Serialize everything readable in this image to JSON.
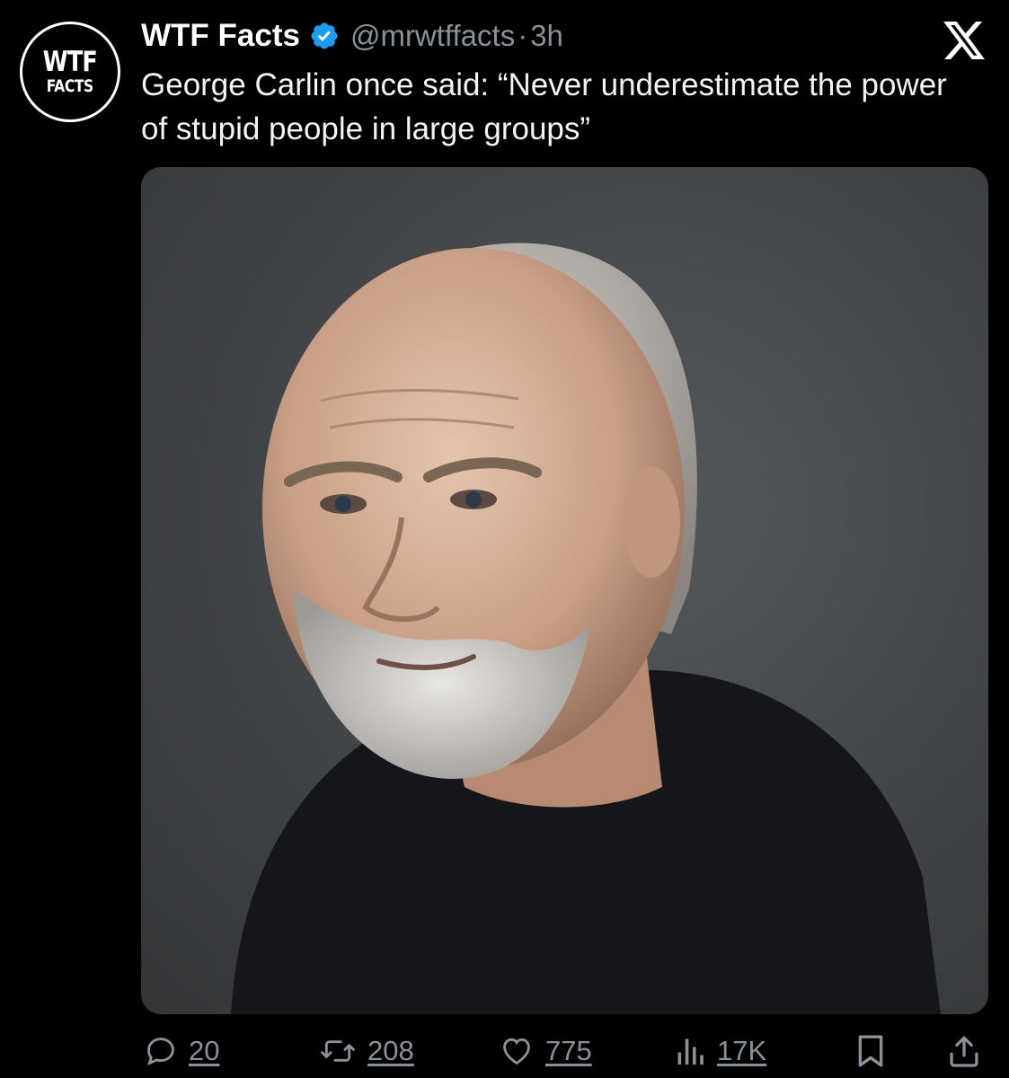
{
  "tweet": {
    "avatar": {
      "line1": "WTF",
      "line2": "FACTS"
    },
    "author": {
      "display_name": "WTF Facts",
      "handle": "@mrwtffacts",
      "separator": "·",
      "time": "3h",
      "verified_icon": "verified-badge-icon",
      "verified_color": "#1d9bf0"
    },
    "text": "George Carlin once said: “Never underestimate the power of stupid people in large groups”",
    "media": {
      "kind": "photo-portrait"
    },
    "actions": {
      "replies": "20",
      "reposts": "208",
      "likes": "775",
      "views": "17K"
    },
    "icons": {
      "reply": "reply-icon",
      "repost": "repost-icon",
      "like": "heart-icon",
      "views": "views-chart-icon",
      "bookmark": "bookmark-icon",
      "share": "share-icon",
      "brand": "x-logo-icon"
    }
  },
  "colors": {
    "background": "#000000",
    "text_primary": "#ffffff",
    "text_secondary": "#8b9198",
    "verified": "#1d9bf0"
  }
}
